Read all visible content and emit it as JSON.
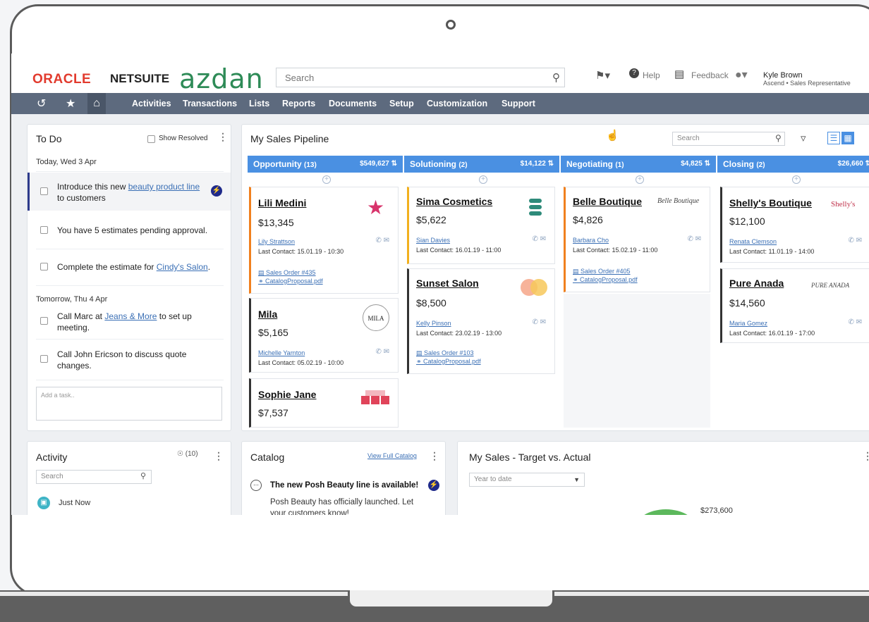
{
  "header": {
    "brand_oracle": "ORACLE",
    "brand_netsuite": "NETSUITE",
    "brand_client": "azdan",
    "search_placeholder": "Search",
    "help_label": "Help",
    "feedback_label": "Feedback",
    "user_name": "Kyle Brown",
    "user_role": "Ascend • Sales Representative"
  },
  "nav": {
    "items": [
      "Activities",
      "Transactions",
      "Lists",
      "Reports",
      "Documents",
      "Setup",
      "Customization",
      "Support"
    ]
  },
  "todo": {
    "title": "To Do",
    "show_resolved": "Show Resolved",
    "today_label": "Today, Wed 3 Apr",
    "tomorrow_label": "Tomorrow, Thu 4 Apr",
    "tasks_today": [
      {
        "pre": "Introduce this new ",
        "link": "beauty product line",
        "post": "to customers"
      },
      {
        "pre": "You have 5 estimates pending approval.",
        "link": "",
        "post": ""
      },
      {
        "pre": "Complete the estimate for ",
        "link": "Cindy's Salon",
        "post": "."
      }
    ],
    "tasks_tomorrow": [
      {
        "pre": "Call Marc at ",
        "link": "Jeans & More",
        "post": " to set up",
        "line2": "meeting."
      },
      {
        "pre": "Call John Ericson to discuss quote",
        "link": "",
        "post": "",
        "line2": "changes."
      }
    ],
    "add_placeholder": "Add a task.."
  },
  "pipeline": {
    "title": "My Sales Pipeline",
    "search_placeholder": "Search",
    "stages": [
      {
        "name": "Opportunity",
        "count": "(13)",
        "amount": "$549,627"
      },
      {
        "name": "Solutioning",
        "count": "(2)",
        "amount": "$14,122"
      },
      {
        "name": "Negotiating",
        "count": "(1)",
        "amount": "$4,825"
      },
      {
        "name": "Closing",
        "count": "(2)",
        "amount": "$26,660"
      }
    ],
    "cards": [
      {
        "name": "Lili Medini",
        "amount": "$13,345",
        "contact": "Lily Strattson",
        "last": "Last Contact: 15.01.19 - 10:30",
        "docs": [
          "Sales Order #435",
          "CatalogProposal.pdf"
        ],
        "logo": "star"
      },
      {
        "name": "Mila",
        "amount": "$5,165",
        "contact": "Michelle Yarnton",
        "last": "Last Contact: 05.02.19 - 10:00",
        "docs": [],
        "logo": "MILA"
      },
      {
        "name": "Sophie Jane",
        "amount": "$7,537",
        "contact": "",
        "last": "",
        "docs": [],
        "logo": "bags"
      },
      {
        "name": "Sima Cosmetics",
        "amount": "$5,622",
        "contact": "Sian Davies",
        "last": "Last Contact: 16.01.19 - 11:00",
        "docs": [],
        "logo": "sima"
      },
      {
        "name": "Sunset Salon",
        "amount": "$8,500",
        "contact": "Kelly Pinson",
        "last": "Last Contact: 23.02.19 - 13:00",
        "docs": [
          "Sales Order #103",
          "CatalogProposal.pdf"
        ],
        "logo": "circles"
      },
      {
        "name": "Belle Boutique",
        "amount": "$4,826",
        "contact": "Barbara Cho",
        "last": "Last Contact: 15.02.19 - 11:00",
        "docs": [
          "Sales Order #405",
          "CatalogProposal.pdf"
        ],
        "logo": "Belle Boutique"
      },
      {
        "name": "Shelly's Boutique",
        "amount": "$12,100",
        "contact": "Renata Clemson",
        "last": "Last Contact: 11.01.19 - 14:00",
        "docs": [],
        "logo": "Shelly's"
      },
      {
        "name": "Pure Anada",
        "amount": "$14,560",
        "contact": "Maria Gomez",
        "last": "Last Contact: 16.01.19 - 17:00",
        "docs": [],
        "logo": "PURE ANADA"
      }
    ]
  },
  "activity": {
    "title": "Activity",
    "pin_count": "(10)",
    "search_placeholder": "Search",
    "first_item": "Just Now"
  },
  "catalog": {
    "title": "Catalog",
    "view_link": "View Full Catalog",
    "headline": "The new Posh Beauty line is available!",
    "body_line1": "Posh Beauty has officially launched. Let",
    "body_line2": "your customers know!"
  },
  "sales": {
    "title": "My Sales - Target vs. Actual",
    "period": "Year to date",
    "value_label": "$273,600"
  },
  "colors": {
    "nav_bg": "#5d6a7e",
    "stage_blue": "#4a90e2",
    "oracle_red": "#e23b2e",
    "azdan_green": "#2e8b57",
    "link_blue": "#3a6fb5",
    "accent_yellow": "#f2b01e",
    "accent_orange": "#f0801e"
  }
}
